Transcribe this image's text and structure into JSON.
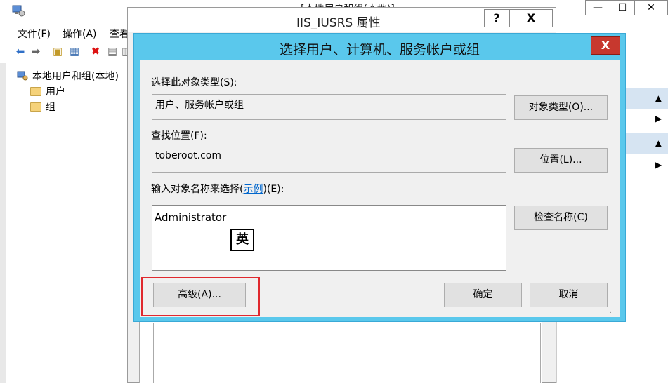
{
  "main_window": {
    "title": "[本地用户和组(本地)]",
    "minimize_glyph": "—",
    "maximize_glyph": "☐",
    "close_glyph": "✕"
  },
  "menubar": {
    "items": [
      "文件(F)",
      "操作(A)",
      "查看"
    ]
  },
  "toolbar": {
    "icons": [
      "back-arrow-icon",
      "forward-arrow-icon",
      "up-folder-icon",
      "show-hide-tree-icon",
      "delete-icon",
      "properties-icon",
      "export-list-icon"
    ]
  },
  "tree": {
    "root": "本地用户和组(本地)",
    "children": [
      "用户",
      "组"
    ]
  },
  "props_window": {
    "title": "IIS_IUSRS 属性",
    "help_glyph": "?",
    "close_glyph": "X"
  },
  "dialog": {
    "title": "选择用户、计算机、服务帐户或组",
    "close_glyph": "X",
    "object_type_label": "选择此对象类型(S):",
    "object_type_value": "用户、服务帐户或组",
    "object_type_button": "对象类型(O)...",
    "location_label": "查找位置(F):",
    "location_value": "toberoot.com",
    "location_button": "位置(L)...",
    "names_label_prefix": "输入对象名称来选择(",
    "names_label_link": "示例",
    "names_label_suffix": ")(E):",
    "names_value": "Administrator",
    "ime_indicator": "英",
    "check_names_button": "检查名称(C)",
    "advanced_button": "高级(A)...",
    "ok_button": "确定",
    "cancel_button": "取消"
  },
  "colors": {
    "dialog_frame": "#5ac8ec",
    "close_red": "#c7382e",
    "highlight_red": "#e0282e",
    "link_blue": "#0066cc"
  }
}
